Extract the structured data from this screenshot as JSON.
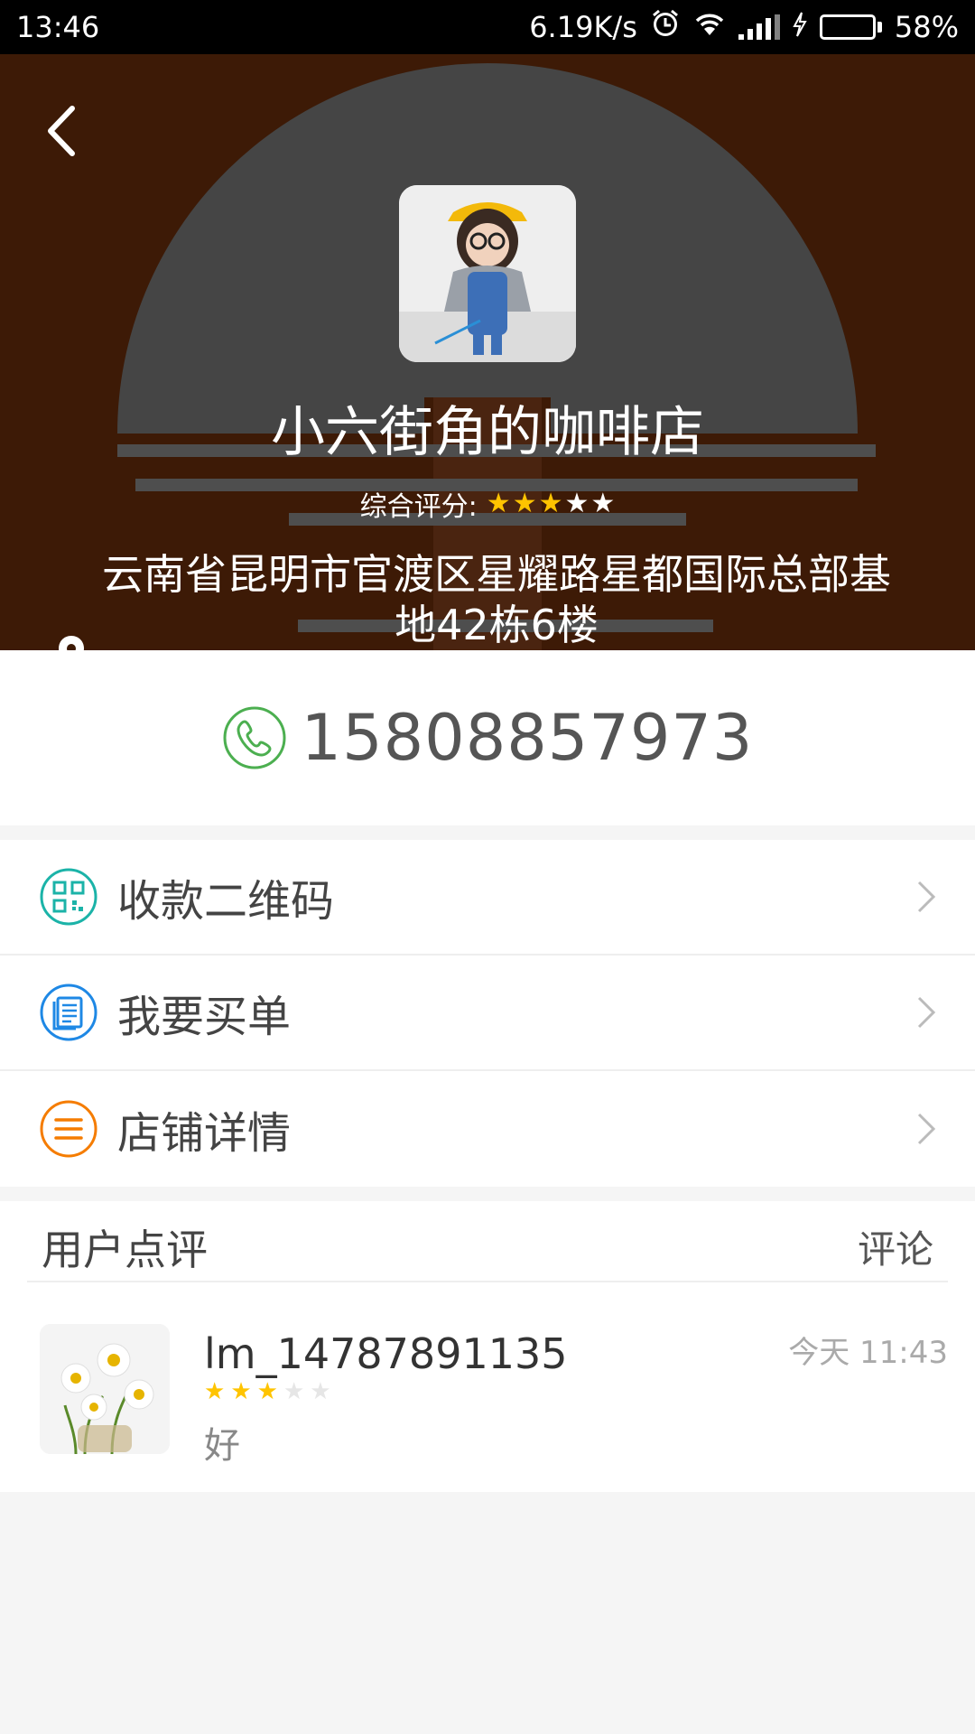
{
  "status_bar": {
    "time": "13:46",
    "speed": "6.19K/s",
    "battery": "58%",
    "battery_level": 0.58
  },
  "header": {
    "shop_name": "小六街角的咖啡店",
    "rating_label": "综合评分:",
    "rating_stars": 3,
    "rating_max": 5,
    "address": "云南省昆明市官渡区星耀路星都国际总部基地42栋6楼"
  },
  "phone": {
    "number": "15808857973"
  },
  "menu": {
    "items": [
      {
        "label": "收款二维码",
        "icon": "qr-code-icon",
        "color": "#1bb3a8"
      },
      {
        "label": "我要买单",
        "icon": "bill-icon",
        "color": "#1e88e5"
      },
      {
        "label": "店铺详情",
        "icon": "details-icon",
        "color": "#f57c00"
      }
    ]
  },
  "reviews": {
    "title": "用户点评",
    "comment_label": "评论",
    "items": [
      {
        "user": "lm_14787891135",
        "time": "今天 11:43",
        "stars": 3,
        "stars_max": 5,
        "text": "好"
      }
    ]
  }
}
